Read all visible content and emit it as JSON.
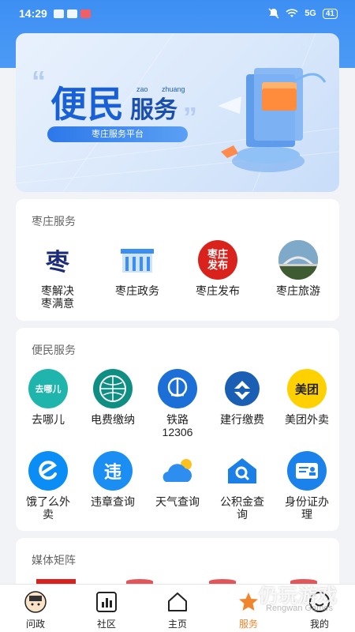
{
  "status_bar": {
    "time": "14:29",
    "battery": "41",
    "signal": "5G"
  },
  "banner": {
    "title_big": "便民",
    "title_small": "服务",
    "pinyin_1": "zao",
    "pinyin_2": "zhuang",
    "subtitle": "枣庄服务平台"
  },
  "zaozhuang_section": {
    "title": "枣庄服务",
    "items": [
      {
        "label": "枣解决\n枣满意",
        "icon": "zao-calligraphy-icon",
        "color": "#1b2d7a",
        "glyph": "枣"
      },
      {
        "label": "枣庄政务",
        "icon": "government-building-icon",
        "color": "#3b8ff2",
        "glyph": ""
      },
      {
        "label": "枣庄发布",
        "icon": "zaozhuang-release-icon",
        "color": "#d9221b",
        "glyph": "枣庄\n发布"
      },
      {
        "label": "枣庄旅游",
        "icon": "tourism-bridge-icon",
        "color": "#4a6b3a",
        "glyph": ""
      }
    ]
  },
  "convenience_section": {
    "title": "便民服务",
    "items": [
      {
        "label": "去哪儿",
        "icon": "qunar-camel-icon",
        "color": "#1fb5ad",
        "glyph": "去哪儿"
      },
      {
        "label": "电费缴纳",
        "icon": "state-grid-icon",
        "color": "#0f8f83",
        "glyph": ""
      },
      {
        "label": "铁路\n12306",
        "icon": "china-railway-icon",
        "color": "#1b6fd6",
        "glyph": ""
      },
      {
        "label": "建行缴费",
        "icon": "ccb-bank-icon",
        "color": "#1a5fb4",
        "glyph": ""
      },
      {
        "label": "美团外卖",
        "icon": "meituan-icon",
        "color": "#ffd100",
        "glyph": "美团"
      },
      {
        "label": "饿了么外\n卖",
        "icon": "eleme-icon",
        "color": "#0a8ef5",
        "glyph": ""
      },
      {
        "label": "违章查询",
        "icon": "violation-search-icon",
        "color": "#1a8ef2",
        "glyph": "违"
      },
      {
        "label": "天气查询",
        "icon": "weather-cloud-icon",
        "color": "#2d8ef0",
        "glyph": ""
      },
      {
        "label": "公积金查\n询",
        "icon": "housing-fund-icon",
        "color": "#1a7fe6",
        "glyph": ""
      },
      {
        "label": "身份证办\n理",
        "icon": "id-card-icon",
        "color": "#1a82ea",
        "glyph": ""
      }
    ]
  },
  "media_section": {
    "title": "媒体矩阵"
  },
  "tabbar": {
    "tabs": [
      {
        "label": "问政",
        "icon": "wenzheng-avatar-icon",
        "active": false
      },
      {
        "label": "社区",
        "icon": "community-chart-icon",
        "active": false
      },
      {
        "label": "主页",
        "icon": "home-icon",
        "active": false
      },
      {
        "label": "服务",
        "icon": "service-star-icon",
        "active": true
      },
      {
        "label": "我的",
        "icon": "profile-smile-icon",
        "active": false
      }
    ]
  },
  "watermark": {
    "text": "仍玩游戏",
    "sub": "Rengwan Games"
  }
}
